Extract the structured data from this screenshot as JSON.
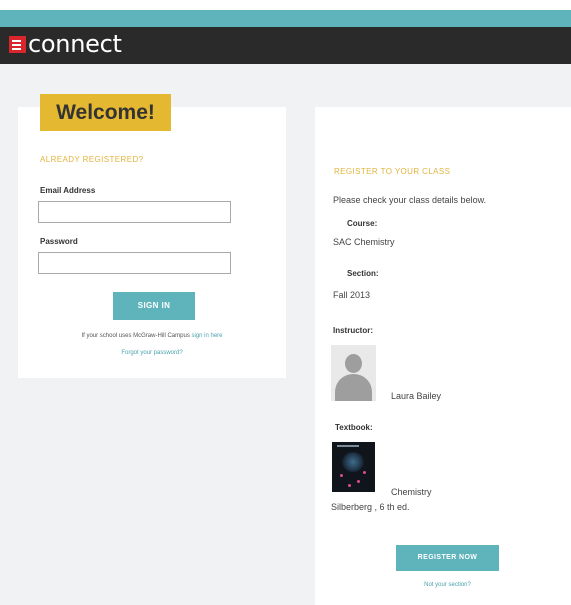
{
  "header": {
    "logo_text": "connect",
    "logo_icon": "mcgraw-hill-logo-icon",
    "colors": {
      "teal_bar": "#5fb3bb",
      "header_bg": "#2a2a2a",
      "logo_red": "#d9262c"
    }
  },
  "sign_in": {
    "welcome": "Welcome!",
    "heading": "ALREADY REGISTERED?",
    "email_label": "Email Address",
    "email_value": "",
    "password_label": "Password",
    "password_value": "",
    "submit_label": "SIGN IN",
    "campus_prefix": "If your school uses McGraw-Hill Campus",
    "campus_link": "sign in here",
    "forgot_link": "Forgot your password?"
  },
  "register": {
    "heading": "REGISTER TO YOUR CLASS",
    "intro": "Please check your class details below.",
    "course_label": "Course:",
    "course_value": "SAC Chemistry",
    "section_label": "Section:",
    "section_value": "Fall 2013",
    "instructor_label": "Instructor:",
    "instructor_name": "Laura Bailey",
    "textbook_label": "Textbook:",
    "textbook_title": "Chemistry",
    "textbook_author": "Silberberg , 6 th ed.",
    "submit_label": "REGISTER NOW",
    "not_section_link": "Not your section?"
  },
  "colors": {
    "accent_yellow": "#e4b830",
    "button_teal": "#5fb3bb",
    "link_teal": "#4aa3ad"
  }
}
